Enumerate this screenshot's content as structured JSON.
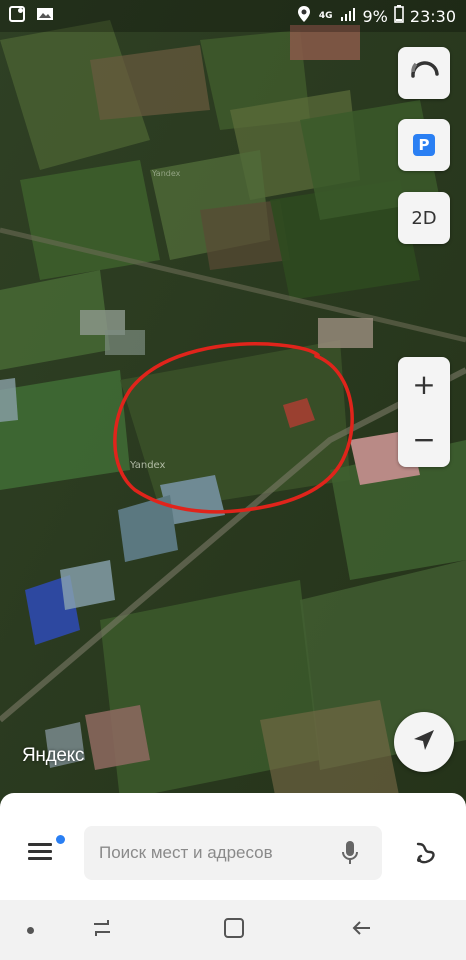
{
  "status_bar": {
    "network_type": "4G",
    "battery_percent": "9%",
    "time": "23:30",
    "icons": [
      "notification-square-icon",
      "image-icon",
      "location-pin-icon",
      "signal-icon",
      "battery-icon"
    ]
  },
  "map": {
    "type": "satellite",
    "watermark_1": "Yandex",
    "watermark_2": "Yandex",
    "annotation": "red hand-drawn circle around plot"
  },
  "controls": {
    "two_d_label": "2D",
    "zoom_in_label": "+",
    "zoom_out_label": "−",
    "parking_label": "P"
  },
  "logo": {
    "text": "Яндекс"
  },
  "search": {
    "placeholder": "Поиск мест и адресов"
  },
  "colors": {
    "parking_blue": "#2a7ff3",
    "annotation_red": "#e0241b",
    "notification_dot": "#2a7ff3"
  }
}
